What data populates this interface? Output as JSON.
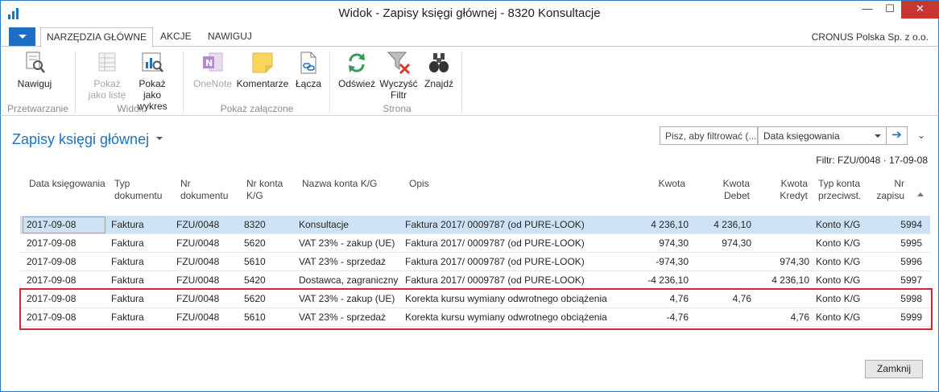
{
  "window": {
    "title": "Widok - Zapisy księgi głównej - 8320 Konsultacje",
    "min_glyph": "—",
    "max_glyph": "☐",
    "close_glyph": "✕"
  },
  "ribbon_tabs": [
    "NARZĘDZIA GŁÓWNE",
    "AKCJE",
    "NAWIGUJ"
  ],
  "company": "CRONUS Polska Sp. z o.o.",
  "ribbon": {
    "navigate": "Nawiguj",
    "show_list_1": "Pokaż",
    "show_list_2": "jako listę",
    "show_chart_1": "Pokaż jako",
    "show_chart_2": "wykres",
    "onenote": "OneNote",
    "comments": "Komentarze",
    "links": "Łącza",
    "refresh": "Odśwież",
    "clear_filter_1": "Wyczyść",
    "clear_filter_2": "Filtr",
    "find": "Znajdź",
    "groups": {
      "processing": "Przetwarzanie",
      "view": "Widok",
      "attachments": "Pokaż załączone",
      "page": "Strona"
    }
  },
  "page": {
    "title": "Zapisy księgi głównej",
    "search_placeholder": "Pisz, aby filtrować (...",
    "search_field": "Data księgowania",
    "go_glyph": "➔",
    "collapse_glyph": "⌄",
    "filter": "Filtr: FZU/0048 · 17-09-08"
  },
  "columns": {
    "date": "Data księgowania",
    "doc_type_1": "Typ",
    "doc_type_2": "dokumentu",
    "doc_no_1": "Nr",
    "doc_no_2": "dokumentu",
    "acc_no_1": "Nr konta",
    "acc_no_2": "K/G",
    "acc_name": "Nazwa konta K/G",
    "desc": "Opis",
    "amount": "Kwota",
    "debit_1": "Kwota",
    "debit_2": "Debet",
    "credit_1": "Kwota",
    "credit_2": "Kredyt",
    "bal_1": "Typ konta",
    "bal_2": "przeciwst.",
    "entry_1": "Nr",
    "entry_2": "zapisu"
  },
  "rows": [
    {
      "date": "2017-09-08",
      "type": "Faktura",
      "doc": "FZU/0048",
      "acc": "8320",
      "name": "Konsultacje",
      "desc": "Faktura 2017/ 0009787 (od PURE-LOOK)",
      "amount": "4 236,10",
      "debit": "4 236,10",
      "credit": "",
      "bal": "Konto K/G",
      "entry": "5994"
    },
    {
      "date": "2017-09-08",
      "type": "Faktura",
      "doc": "FZU/0048",
      "acc": "5620",
      "name": "VAT 23% - zakup (UE)",
      "desc": "Faktura 2017/ 0009787 (od PURE-LOOK)",
      "amount": "974,30",
      "debit": "974,30",
      "credit": "",
      "bal": "Konto K/G",
      "entry": "5995"
    },
    {
      "date": "2017-09-08",
      "type": "Faktura",
      "doc": "FZU/0048",
      "acc": "5610",
      "name": "VAT 23% - sprzedaż",
      "desc": "Faktura 2017/ 0009787 (od PURE-LOOK)",
      "amount": "-974,30",
      "debit": "",
      "credit": "974,30",
      "bal": "Konto K/G",
      "entry": "5996"
    },
    {
      "date": "2017-09-08",
      "type": "Faktura",
      "doc": "FZU/0048",
      "acc": "5420",
      "name": "Dostawca, zagraniczny",
      "desc": "Faktura 2017/ 0009787 (od PURE-LOOK)",
      "amount": "-4 236,10",
      "debit": "",
      "credit": "4 236,10",
      "bal": "Konto K/G",
      "entry": "5997"
    },
    {
      "date": "2017-09-08",
      "type": "Faktura",
      "doc": "FZU/0048",
      "acc": "5620",
      "name": "VAT 23% - zakup (UE)",
      "desc": "Korekta kursu wymiany odwrotnego obciążenia",
      "amount": "4,76",
      "debit": "4,76",
      "credit": "",
      "bal": "Konto K/G",
      "entry": "5998"
    },
    {
      "date": "2017-09-08",
      "type": "Faktura",
      "doc": "FZU/0048",
      "acc": "5610",
      "name": "VAT 23% - sprzedaż",
      "desc": "Korekta kursu wymiany odwrotnego obciążenia",
      "amount": "-4,76",
      "debit": "",
      "credit": "4,76",
      "bal": "Konto K/G",
      "entry": "5999"
    }
  ],
  "close_button": "Zamknij",
  "colors": {
    "accent": "#1e73be",
    "selected_row": "#cde3f5",
    "highlight": "#d7262e"
  }
}
